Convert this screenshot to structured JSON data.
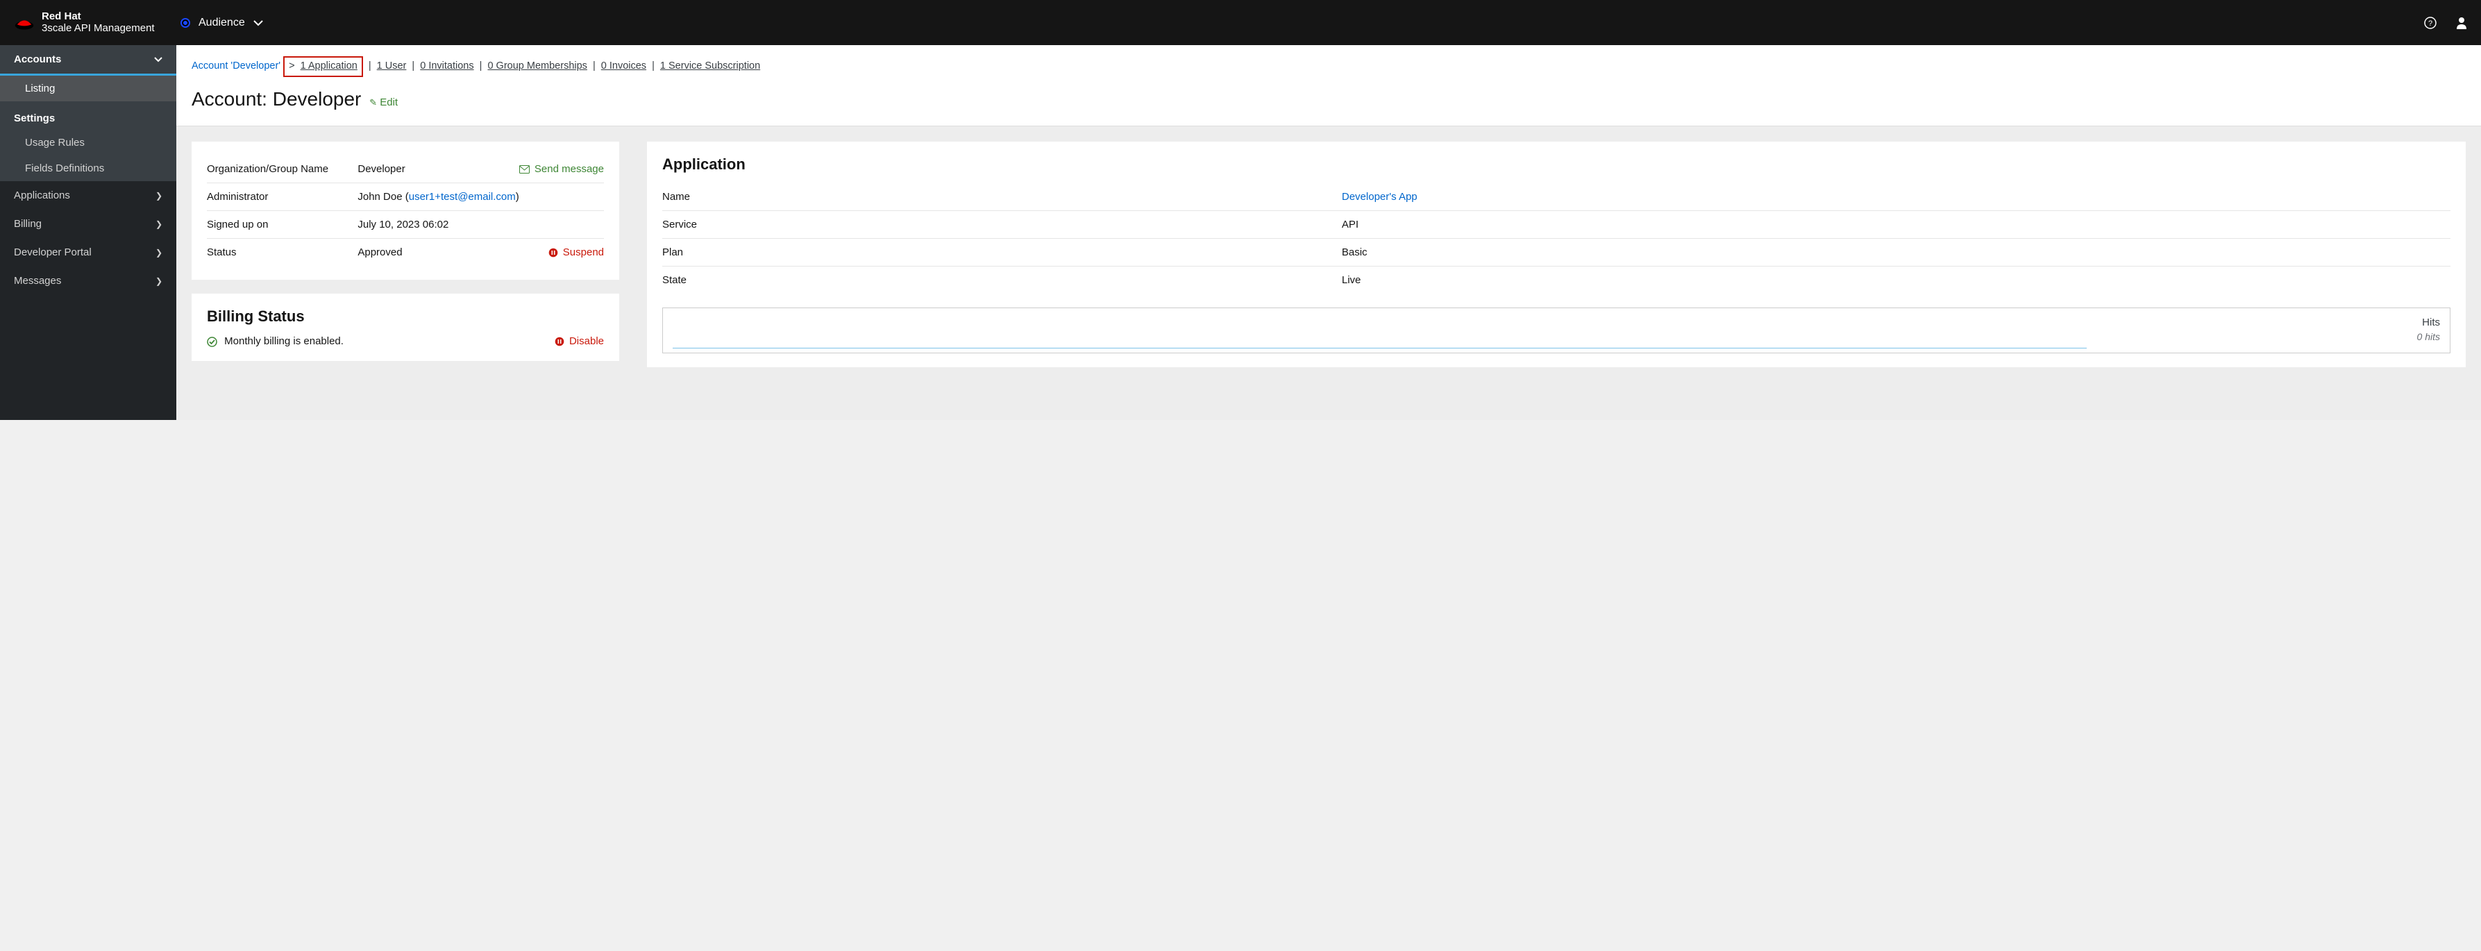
{
  "brand": {
    "line1": "Red Hat",
    "line2": "3scale API Management"
  },
  "audience_label": "Audience",
  "sidebar": {
    "accounts": "Accounts",
    "listing": "Listing",
    "settings": "Settings",
    "usage_rules": "Usage Rules",
    "fields_defs": "Fields Definitions",
    "applications": "Applications",
    "billing": "Billing",
    "dev_portal": "Developer Portal",
    "messages": "Messages"
  },
  "crumbs": {
    "account": "Account 'Developer'",
    "arrow": ">",
    "app": "1 Application",
    "user": "1 User",
    "invitations": "0 Invitations",
    "groups": "0 Group Memberships",
    "invoices": "0 Invoices",
    "subs": "1 Service Subscription"
  },
  "title": "Account: Developer",
  "edit": "Edit",
  "details": {
    "org_label": "Organization/Group Name",
    "org_value": "Developer",
    "send_message": "Send message",
    "admin_label": "Administrator",
    "admin_name": "John Doe (",
    "admin_email": "user1+test@email.com",
    "admin_close": ")",
    "signed_label": "Signed up on",
    "signed_value": "July 10, 2023 06:02",
    "status_label": "Status",
    "status_value": "Approved",
    "suspend": "Suspend"
  },
  "billing": {
    "title": "Billing Status",
    "text": "Monthly billing is enabled.",
    "disable": "Disable"
  },
  "application": {
    "title": "Application",
    "name_label": "Name",
    "name_value": "Developer's App",
    "service_label": "Service",
    "service_value": "API",
    "plan_label": "Plan",
    "plan_value": "Basic",
    "state_label": "State",
    "state_value": "Live",
    "hits_label": "Hits",
    "hits_value": "0 hits"
  }
}
